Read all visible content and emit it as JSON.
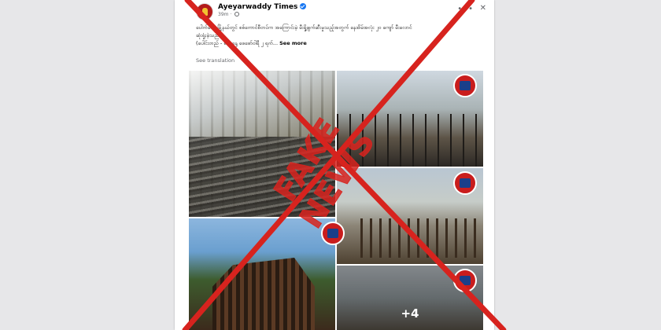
{
  "post": {
    "page_name": "Ayeyarwaddy Times",
    "time": "39m",
    "body_lines": [
      "ပေါက်တောမြို့နယ်တွင် စစ်ကောင်စီတပ်က အကြောင်းမဲ့ မီးရှို့ဖျက်ဆီးမှုသည့်အတွက် နေအိမ်အလုံး ၂၀ ကျော် မီးလောင်",
      "ဆုံးရှုံးခဲ့သည်",
      "(ပေါင်းတည် - စနေနေ့ ဖေဖော်ဝါရီ ၂ ရက်"
    ],
    "see_more_label": "See more",
    "see_translation_label": "See translation",
    "more_photos_label": "+4"
  },
  "stamp": {
    "text": "FAKE NEWS",
    "color": "#d7231e"
  },
  "icons": {
    "avatar": "news-logo-icon",
    "verified": "verified-badge-icon",
    "privacy": "globe-icon",
    "menu": "more-options-icon",
    "close": "close-icon",
    "watermark": "watermark-logo-icon"
  }
}
